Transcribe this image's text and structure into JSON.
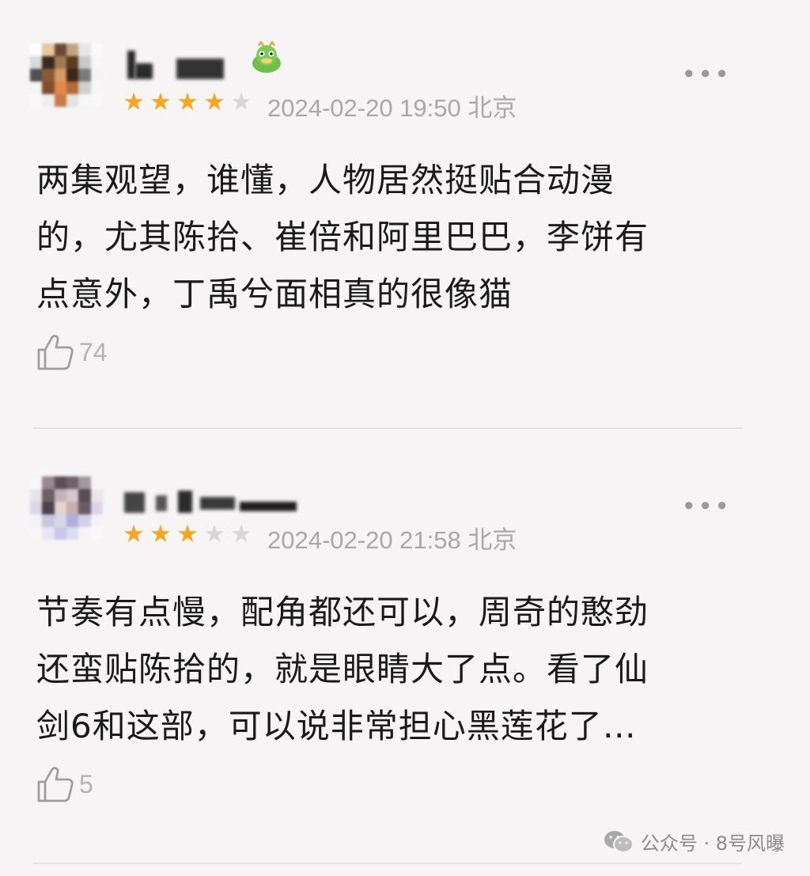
{
  "comments": [
    {
      "rating": 4,
      "timestamp": "2024-02-20 19:50",
      "location": "北京",
      "text_lines": [
        "两集观望，谁懂，人物居然挺贴合动漫",
        "的，尤其陈拾、崔倍和阿里巴巴，李饼有",
        "点意外，丁禹兮面相真的很像猫"
      ],
      "likes": "74"
    },
    {
      "rating": 3,
      "timestamp": "2024-02-20 21:58",
      "location": "北京",
      "text_lines": [
        "节奏有点慢，配角都还可以，周奇的憨劲",
        "还蛮贴陈拾的，就是眼睛大了点。看了仙",
        "剑6和这部，可以说非常担心黑莲花了…"
      ],
      "likes": "5"
    }
  ],
  "more_label": "•••",
  "star_glyph": "★",
  "icons": [
    "thumbs-up-icon",
    "more-options-icon",
    "dragon-badge-icon",
    "wechat-icon"
  ],
  "colors": {
    "star_on": "#f5a623",
    "star_off": "#d7d7d7",
    "meta": "#a8a8a8"
  },
  "watermark": {
    "label": "公众号 · 8号风曝"
  }
}
